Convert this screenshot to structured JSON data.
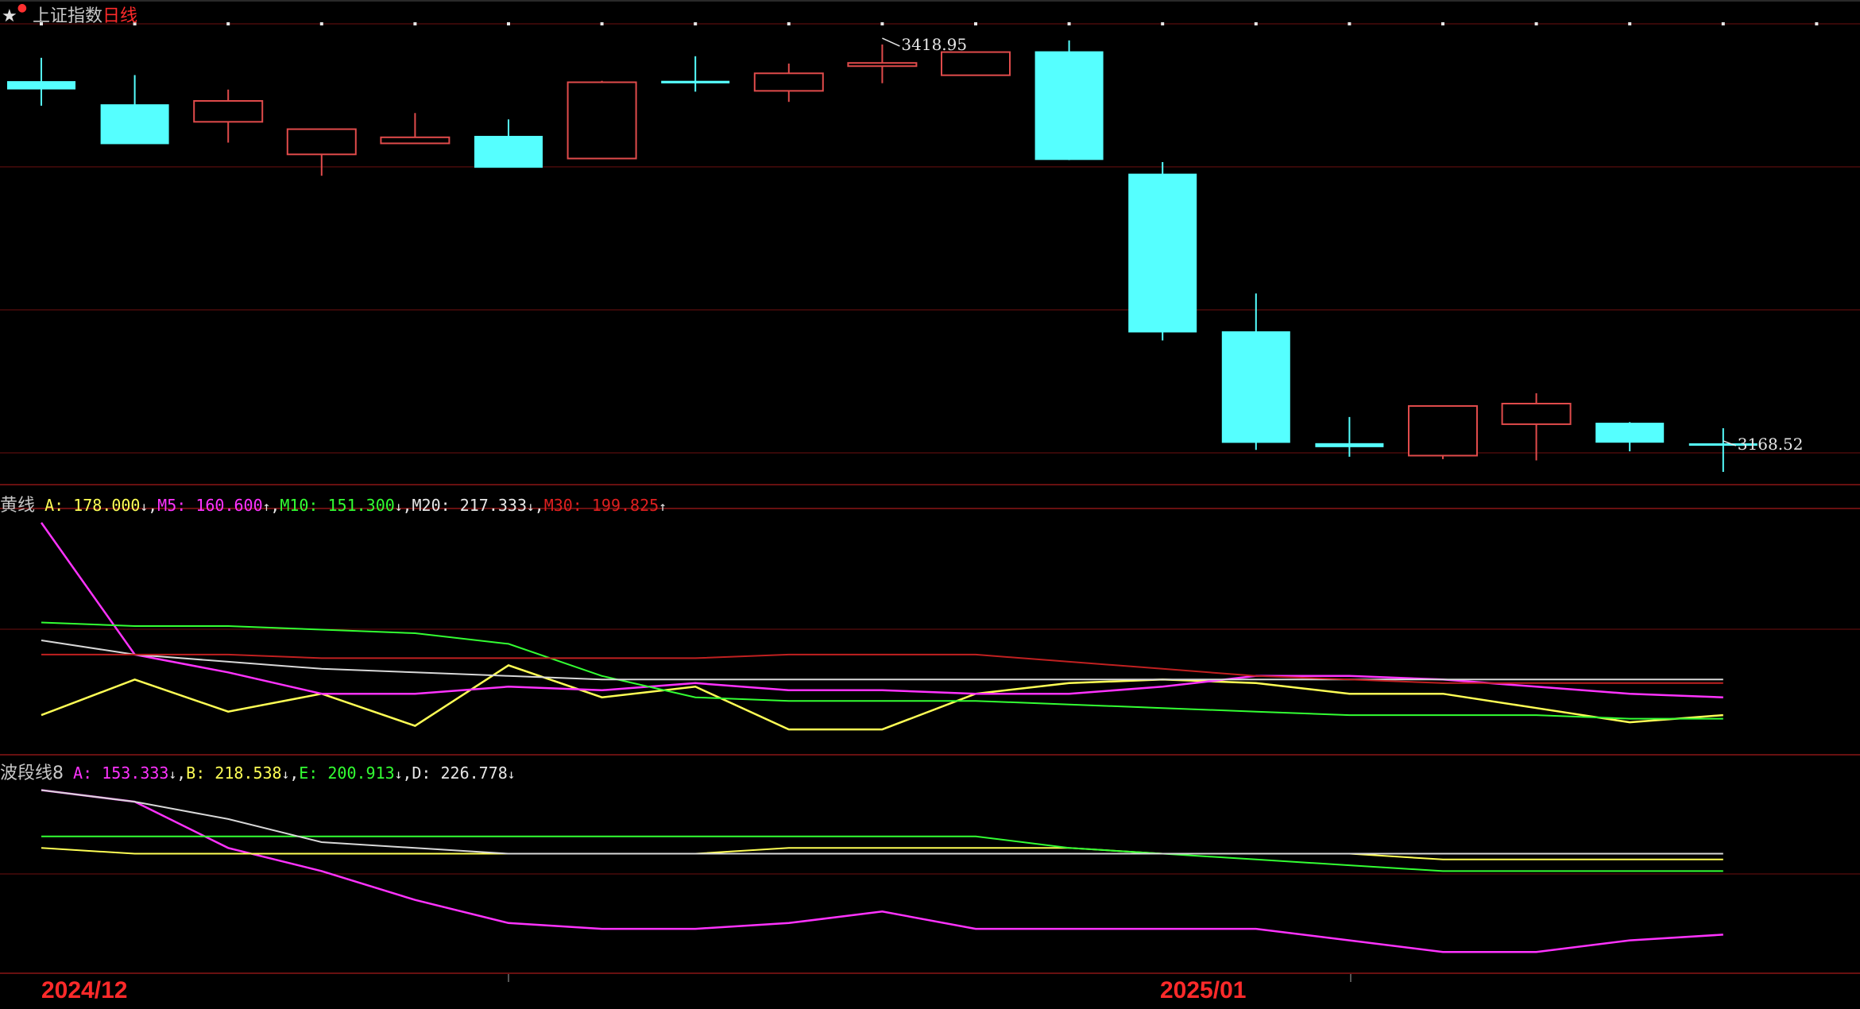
{
  "header": {
    "star_icon": "star-icon",
    "index_name": "上证指数",
    "period": "日线"
  },
  "colors": {
    "background": "#000000",
    "up": "#e04b4b",
    "down": "#55ffff",
    "grid": "#6e1010",
    "yellow": "#ffff55",
    "magenta": "#ff33ff",
    "green": "#33ff33",
    "white": "#d8d8d8",
    "red": "#c02020"
  },
  "price_labels": {
    "high": "3418.95",
    "low": "3168.52"
  },
  "date_labels": [
    "2024/12",
    "2025/01"
  ],
  "indicator1": {
    "name": "黄线",
    "items": [
      {
        "text": "A: 178.000",
        "arrow": "↓",
        "color": "#ffff55"
      },
      {
        "text": "M5: 160.600",
        "arrow": "↑",
        "color": "#ff33ff"
      },
      {
        "text": "M10: 151.300",
        "arrow": "↓",
        "color": "#33ff33"
      },
      {
        "text": "M20: 217.333",
        "arrow": "↓",
        "color": "#e6e6e6"
      },
      {
        "text": "M30: 199.825",
        "arrow": "↑",
        "color": "#e02020"
      }
    ]
  },
  "indicator2": {
    "name": "波段线8",
    "items": [
      {
        "text": "A: 153.333",
        "arrow": "↓",
        "color": "#ff33ff"
      },
      {
        "text": "B: 218.538",
        "arrow": "↓",
        "color": "#ffff55"
      },
      {
        "text": "E: 200.913",
        "arrow": "↓",
        "color": "#33ff33"
      },
      {
        "text": "D: 226.778",
        "arrow": "↓",
        "color": "#e6e6e6"
      }
    ]
  },
  "chart_data": [
    {
      "type": "candlestick",
      "title": "上证指数日线",
      "ylim": [
        3168.52,
        3418.95
      ],
      "candles": [
        {
          "o": 3396.0,
          "h": 3410.6,
          "l": 3380.6,
          "c": 3390.8
        },
        {
          "o": 3381.5,
          "h": 3399.8,
          "l": 3363.0,
          "c": 3356.5
        },
        {
          "o": 3370.5,
          "h": 3390.7,
          "l": 3357.5,
          "c": 3383.6
        },
        {
          "o": 3350.1,
          "h": 3361.2,
          "l": 3336.7,
          "c": 3365.9
        },
        {
          "o": 3357.0,
          "h": 3376.0,
          "l": 3359.7,
          "c": 3360.8
        },
        {
          "o": 3361.7,
          "h": 3372.0,
          "l": 3341.9,
          "c": 3341.7
        },
        {
          "o": 3347.5,
          "h": 3396.2,
          "l": 3347.6,
          "c": 3395.3
        },
        {
          "o": 3396.2,
          "h": 3411.6,
          "l": 3389.4,
          "c": 3394.6
        },
        {
          "o": 3389.9,
          "h": 3407.0,
          "l": 3383.0,
          "c": 3400.9
        },
        {
          "o": 3405.4,
          "h": 3418.95,
          "l": 3394.7,
          "c": 3407.4
        },
        {
          "o": 3399.7,
          "h": 3412.9,
          "l": 3399.6,
          "c": 3414.2
        },
        {
          "o": 3414.7,
          "h": 3421.5,
          "l": 3346.5,
          "c": 3346.6
        },
        {
          "o": 3338.0,
          "h": 3345.3,
          "l": 3233.5,
          "c": 3238.5
        },
        {
          "o": 3239.2,
          "h": 3262.9,
          "l": 3164.9,
          "c": 3169.3
        },
        {
          "o": 3169.1,
          "h": 3185.5,
          "l": 3160.6,
          "c": 3166.6
        },
        {
          "o": 3161.3,
          "h": 3191.8,
          "l": 3159.1,
          "c": 3192.4
        },
        {
          "o": 3181.0,
          "h": 3200.4,
          "l": 3158.3,
          "c": 3193.9
        },
        {
          "o": 3181.9,
          "h": 3182.3,
          "l": 3164.0,
          "c": 3169.4
        },
        {
          "o": 3169.0,
          "h": 3178.5,
          "l": 3151.1,
          "c": 3168.52
        }
      ]
    },
    {
      "type": "line",
      "name": "黄线",
      "series": [
        {
          "name": "A",
          "color": "#ffff55",
          "values": [
            300,
            310,
            301,
            306,
            297,
            314,
            305,
            308,
            296,
            296,
            306,
            309,
            310,
            309,
            306,
            306,
            302,
            298,
            300
          ]
        },
        {
          "name": "M5",
          "color": "#ff33ff",
          "values": [
            354,
            317,
            312,
            306,
            306,
            308,
            307,
            309,
            307,
            307,
            306,
            306,
            308,
            311,
            311,
            310,
            308,
            306,
            305
          ]
        },
        {
          "name": "M10",
          "color": "#33ff33",
          "values": [
            326,
            325,
            325,
            324,
            323,
            320,
            311,
            305,
            304,
            304,
            304,
            303,
            302,
            301,
            300,
            300,
            300,
            299,
            299
          ]
        },
        {
          "name": "M20",
          "color": "#d8d8d8",
          "values": [
            321,
            317,
            315,
            313,
            312,
            311,
            310,
            310,
            310,
            310,
            310,
            310,
            310,
            310,
            310,
            310,
            310,
            310,
            310
          ]
        },
        {
          "name": "M30",
          "color": "#c02020",
          "values": [
            317,
            317,
            317,
            316,
            316,
            316,
            316,
            316,
            317,
            317,
            317,
            315,
            313,
            311,
            310,
            309,
            309,
            309,
            309
          ]
        }
      ]
    },
    {
      "type": "line",
      "name": "波段线8",
      "series": [
        {
          "name": "A",
          "color": "#ff33ff",
          "values": [
            244,
            242,
            234,
            230,
            225,
            221,
            220,
            220,
            221,
            223,
            220,
            220,
            220,
            220,
            218,
            216,
            216,
            218,
            219
          ]
        },
        {
          "name": "B",
          "color": "#ffff55",
          "values": [
            234,
            233,
            233,
            233,
            233,
            233,
            233,
            233,
            234,
            234,
            234,
            234,
            233,
            233,
            233,
            232,
            232,
            232,
            232
          ]
        },
        {
          "name": "E",
          "color": "#33ff33",
          "values": [
            236,
            236,
            236,
            236,
            236,
            236,
            236,
            236,
            236,
            236,
            236,
            234,
            233,
            232,
            231,
            230,
            230,
            230,
            230
          ]
        },
        {
          "name": "D",
          "color": "#d8d8d8",
          "values": [
            244,
            242,
            239,
            235,
            234,
            233,
            233,
            233,
            233,
            233,
            233,
            233,
            233,
            233,
            233,
            233,
            233,
            233,
            233
          ]
        }
      ]
    }
  ]
}
